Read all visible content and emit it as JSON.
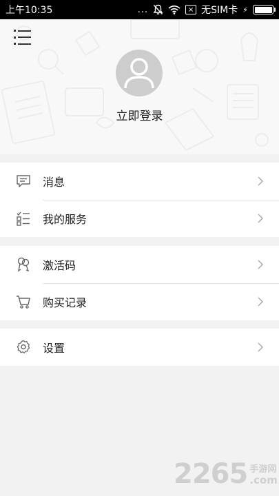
{
  "status_bar": {
    "time": "上午10:35",
    "dots": "...",
    "sim_glyph": "×",
    "carrier": "无SIM卡",
    "charging": "⚡",
    "battery_level": 1.0
  },
  "header": {
    "menu_icon": "list-menu-icon",
    "avatar_icon": "user-avatar-icon",
    "login_label": "立即登录"
  },
  "groups": [
    {
      "items": [
        {
          "label": "消息",
          "icon": "message-icon"
        },
        {
          "label": "我的服务",
          "icon": "service-checklist-icon"
        }
      ]
    },
    {
      "items": [
        {
          "label": "激活码",
          "icon": "key-icon"
        },
        {
          "label": "购买记录",
          "icon": "cart-icon"
        }
      ]
    },
    {
      "items": [
        {
          "label": "设置",
          "icon": "gear-icon"
        }
      ]
    }
  ],
  "watermark": {
    "number": "2265",
    "site_cn": "手游网",
    "suffix": ".com"
  },
  "colors": {
    "background": "#f2f2f2",
    "header_background": "#f8f8f8",
    "avatar": "#cdcdcd",
    "separator": "#e6e6e6",
    "watermark": "#cfcfcf"
  }
}
